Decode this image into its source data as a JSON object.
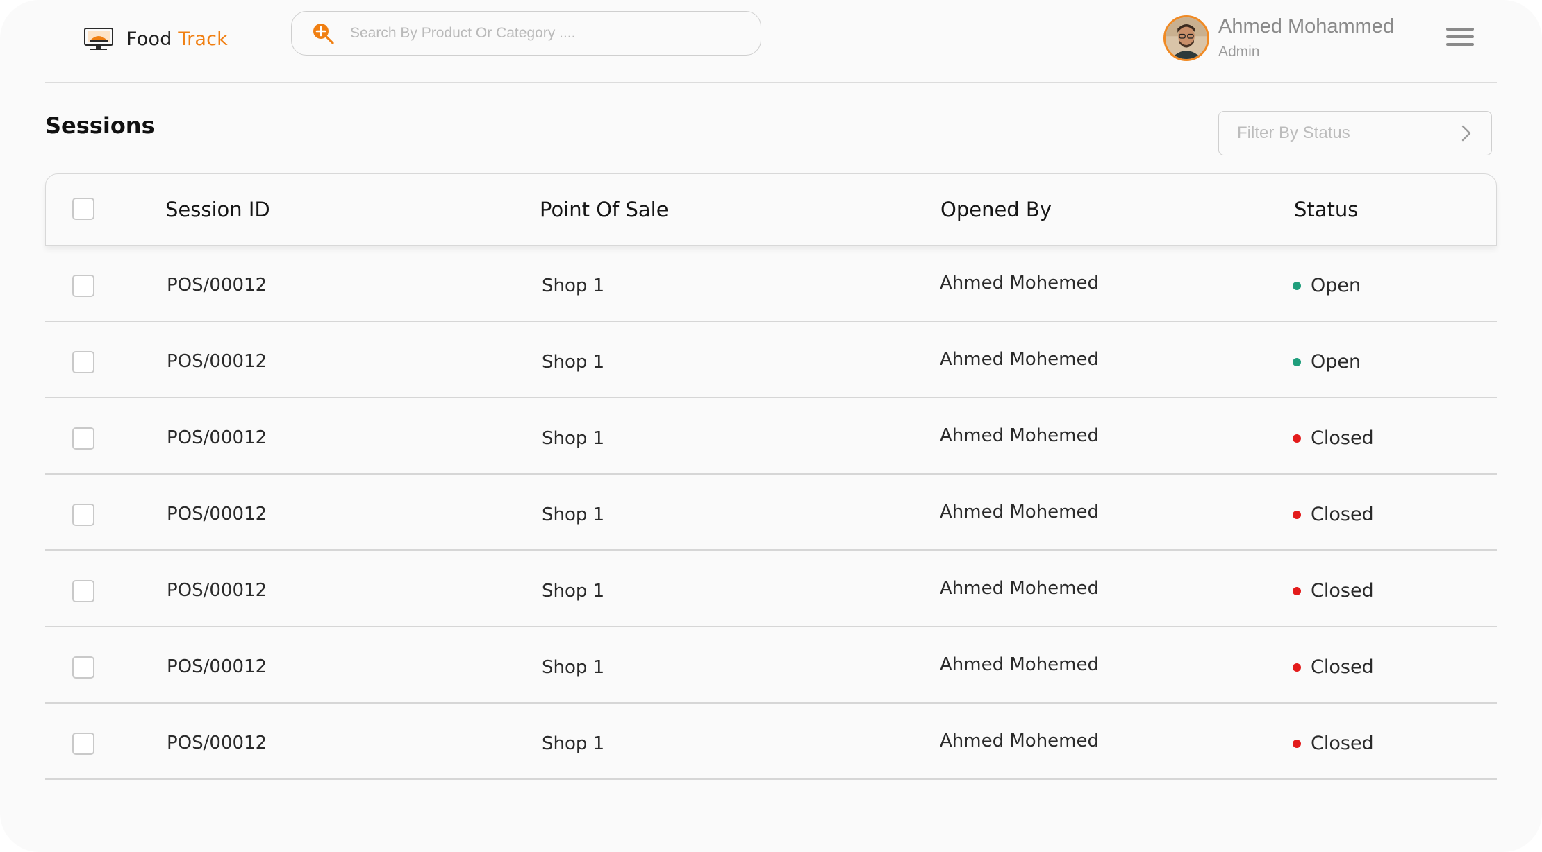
{
  "header": {
    "logo_word1": "Food",
    "logo_word2": "Track",
    "search_placeholder": "Search By Product Or Category ....",
    "user_name": "Ahmed Mohammed",
    "user_role": "Admin"
  },
  "page": {
    "title": "Sessions",
    "filter_label": "Filter By Status"
  },
  "table": {
    "columns": [
      "Session ID",
      "Point Of Sale",
      "Opened By",
      "Status"
    ],
    "rows": [
      {
        "id": "POS/00012",
        "pos": "Shop 1",
        "opened_by": "Ahmed Mohemed",
        "status": "Open"
      },
      {
        "id": "POS/00012",
        "pos": "Shop 1",
        "opened_by": "Ahmed Mohemed",
        "status": "Open"
      },
      {
        "id": "POS/00012",
        "pos": "Shop 1",
        "opened_by": "Ahmed Mohemed",
        "status": "Closed"
      },
      {
        "id": "POS/00012",
        "pos": "Shop 1",
        "opened_by": "Ahmed Mohemed",
        "status": "Closed"
      },
      {
        "id": "POS/00012",
        "pos": "Shop 1",
        "opened_by": "Ahmed Mohemed",
        "status": "Closed"
      },
      {
        "id": "POS/00012",
        "pos": "Shop 1",
        "opened_by": "Ahmed Mohemed",
        "status": "Closed"
      },
      {
        "id": "POS/00012",
        "pos": "Shop 1",
        "opened_by": "Ahmed Mohemed",
        "status": "Closed"
      }
    ]
  },
  "colors": {
    "accent": "#f07f12",
    "status_open": "#1f9e7c",
    "status_closed": "#e31b1b"
  },
  "icons": {
    "logo": "monitor-food-icon",
    "search": "search-add-icon",
    "menu": "hamburger-menu-icon",
    "filter": "chevron-right-icon"
  }
}
